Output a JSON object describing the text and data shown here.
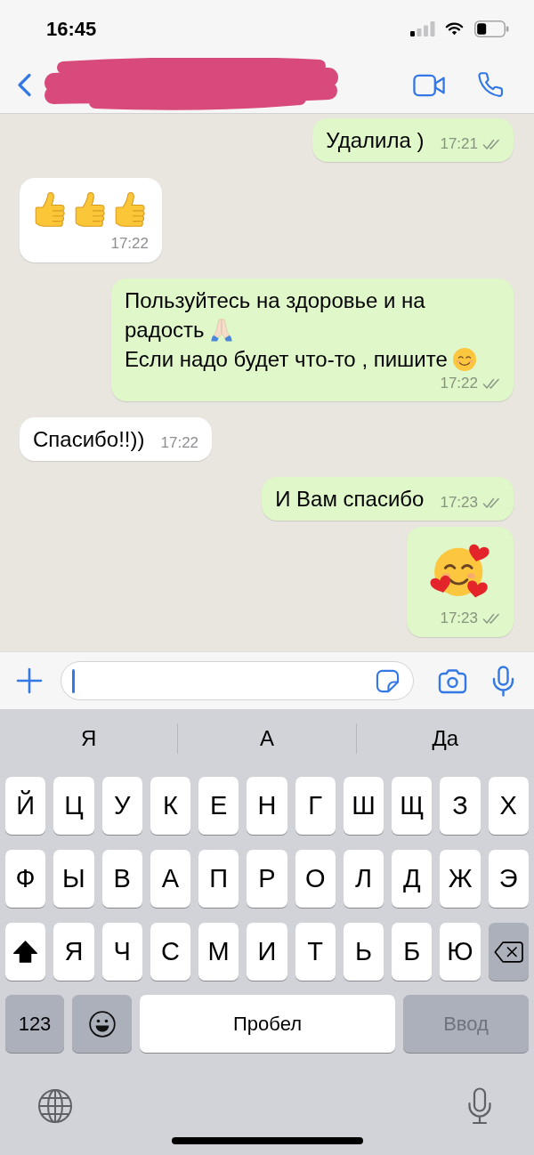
{
  "status_bar": {
    "time": "16:45"
  },
  "messages": [
    {
      "outgoing": true,
      "kind": "text",
      "parts": [
        {
          "kind": "text",
          "text": "Удалила )"
        }
      ],
      "time": "17:21",
      "read": false
    },
    {
      "outgoing": false,
      "kind": "emoji_only",
      "parts": [
        {
          "kind": "thumbs_up"
        },
        {
          "kind": "thumbs_up"
        },
        {
          "kind": "thumbs_up"
        }
      ],
      "time": "17:22"
    },
    {
      "outgoing": true,
      "kind": "text",
      "parts": [
        {
          "kind": "text",
          "text": "Пользуйтесь на здоровье и на"
        },
        {
          "kind": "break"
        },
        {
          "kind": "text",
          "text": "радость"
        },
        {
          "kind": "folded_hands"
        },
        {
          "kind": "break"
        },
        {
          "kind": "text",
          "text": "Если надо будет что-то , пишите"
        },
        {
          "kind": "smiling_face"
        }
      ],
      "time": "17:22",
      "read": false
    },
    {
      "outgoing": false,
      "kind": "text",
      "parts": [
        {
          "kind": "text",
          "text": "Спасибо!!))"
        }
      ],
      "time": "17:22"
    },
    {
      "outgoing": true,
      "kind": "text",
      "parts": [
        {
          "kind": "text",
          "text": "И Вам спасибо"
        }
      ],
      "time": "17:23",
      "read": false
    },
    {
      "outgoing": true,
      "kind": "emoji_only",
      "parts": [
        {
          "kind": "smiling_face_with_hearts"
        }
      ],
      "time": "17:23",
      "read": false
    }
  ],
  "composer": {
    "focused": true
  },
  "suggestions": [
    "Я",
    "А",
    "Да"
  ],
  "keyboard": {
    "letter_rows": [
      [
        {
          "kind": "letter",
          "label": "Й"
        },
        {
          "kind": "letter",
          "label": "Ц"
        },
        {
          "kind": "letter",
          "label": "У"
        },
        {
          "kind": "letter",
          "label": "К"
        },
        {
          "kind": "letter",
          "label": "Е"
        },
        {
          "kind": "letter",
          "label": "Н"
        },
        {
          "kind": "letter",
          "label": "Г"
        },
        {
          "kind": "letter",
          "label": "Ш"
        },
        {
          "kind": "letter",
          "label": "Щ"
        },
        {
          "kind": "letter",
          "label": "З"
        },
        {
          "kind": "letter",
          "label": "Х"
        }
      ],
      [
        {
          "kind": "letter",
          "label": "Ф"
        },
        {
          "kind": "letter",
          "label": "Ы"
        },
        {
          "kind": "letter",
          "label": "В"
        },
        {
          "kind": "letter",
          "label": "А"
        },
        {
          "kind": "letter",
          "label": "П"
        },
        {
          "kind": "letter",
          "label": "Р"
        },
        {
          "kind": "letter",
          "label": "О"
        },
        {
          "kind": "letter",
          "label": "Л"
        },
        {
          "kind": "letter",
          "label": "Д"
        },
        {
          "kind": "letter",
          "label": "Ж"
        },
        {
          "kind": "letter",
          "label": "Э"
        }
      ],
      [
        {
          "kind": "shift",
          "on": true
        },
        {
          "kind": "letter",
          "label": "Я"
        },
        {
          "kind": "letter",
          "label": "Ч"
        },
        {
          "kind": "letter",
          "label": "С"
        },
        {
          "kind": "letter",
          "label": "М"
        },
        {
          "kind": "letter",
          "label": "И"
        },
        {
          "kind": "letter",
          "label": "Т"
        },
        {
          "kind": "letter",
          "label": "Ь"
        },
        {
          "kind": "letter",
          "label": "Б"
        },
        {
          "kind": "letter",
          "label": "Ю"
        },
        {
          "kind": "backspace"
        }
      ]
    ],
    "bottom_row": [
      {
        "kind": "numbers",
        "label": "123"
      },
      {
        "kind": "emoji"
      },
      {
        "kind": "space",
        "label": "Пробел"
      },
      {
        "kind": "enter",
        "label": "Ввод",
        "disabled": true
      }
    ]
  }
}
